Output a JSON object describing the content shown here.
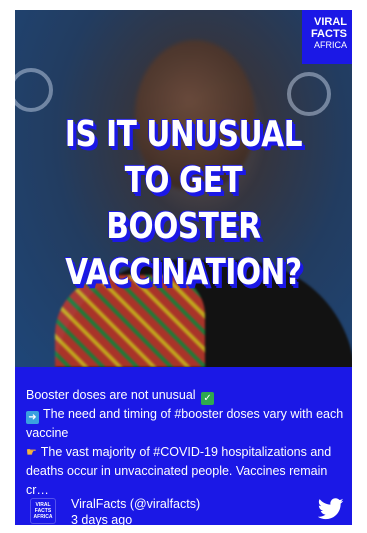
{
  "media": {
    "title_lines": [
      "IS IT UNUSUAL",
      "TO GET BOOSTER",
      "VACCINATION?"
    ],
    "badge": {
      "line1": "VIRAL",
      "line2": "FACTS",
      "line3": "AFRICA"
    }
  },
  "post": {
    "line1": "Booster doses are not unusual",
    "line2": "The need and timing of #booster doses vary with each vaccine",
    "line3": "The vast majority of #COVID-19 hospitalizations and deaths occur in unvaccinated people. Vaccines remain cr…"
  },
  "footer": {
    "avatar": {
      "line1": "VIRAL",
      "line2": "FACTS",
      "line3": "AFRICA"
    },
    "author": "ViralFacts (@viralfacts)",
    "time": "3 days ago"
  },
  "icons": {
    "check": "check-mark-icon",
    "arrow": "right-arrow-icon",
    "point": "pointing-hand-icon",
    "twitter": "twitter-bird-icon"
  },
  "colors": {
    "brand": "#1b18e6",
    "text": "#ffffff",
    "check": "#2fa84f",
    "arrow": "#3aa0e0"
  }
}
